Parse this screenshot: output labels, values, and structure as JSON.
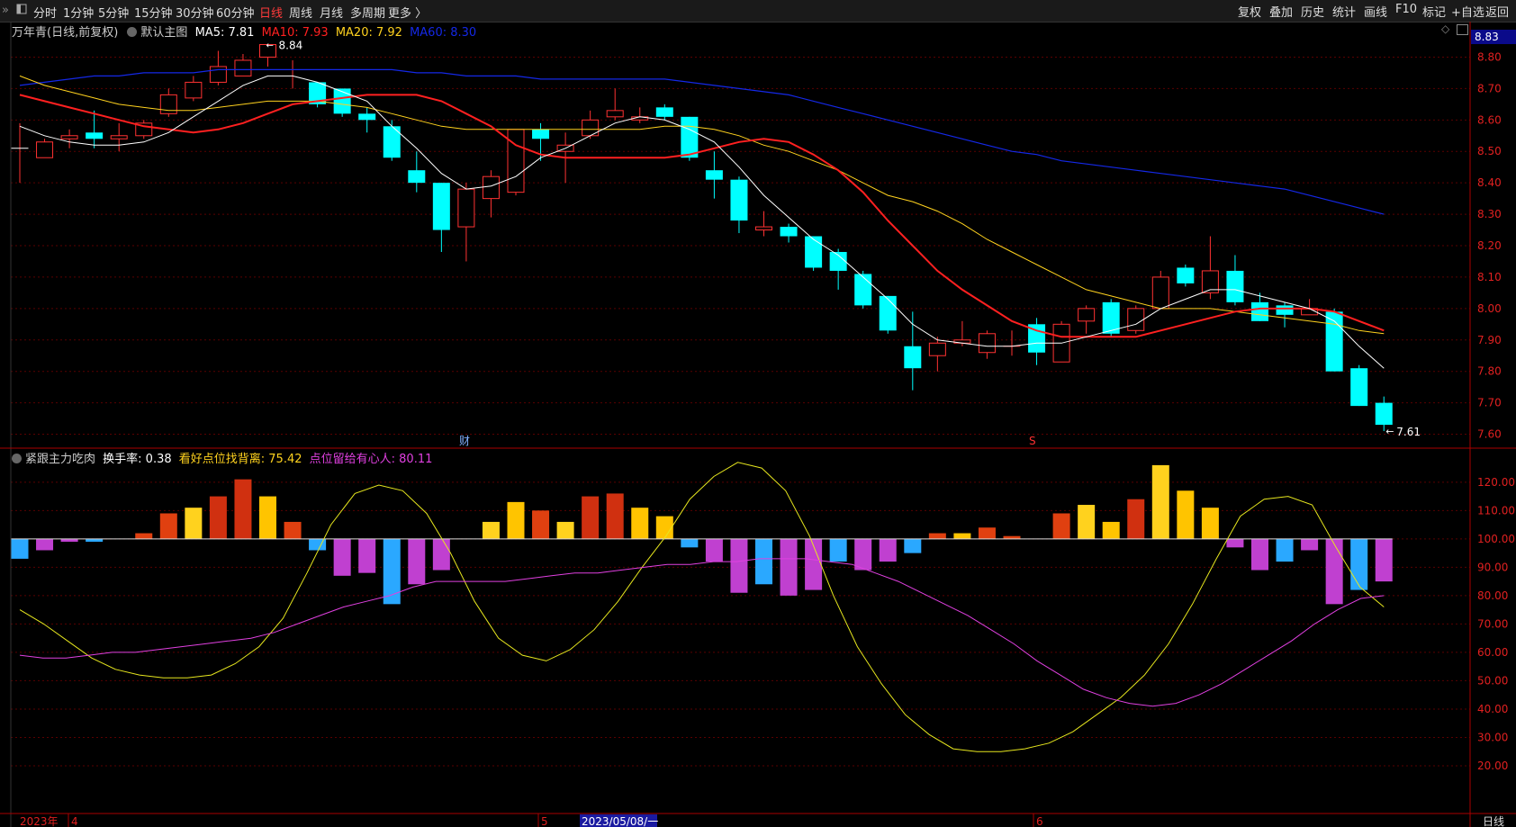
{
  "toolbar": {
    "periods": [
      "分时",
      "1分钟",
      "5分钟",
      "15分钟",
      "30分钟",
      "60分钟",
      "日线",
      "周线",
      "月线",
      "多周期",
      "更多 〉"
    ],
    "active_period": "日线",
    "right_buttons": [
      "复权",
      "叠加",
      "历史",
      "统计",
      "画线",
      "F10",
      "标记",
      "+自选",
      "返回"
    ]
  },
  "main_legend": {
    "title": "万年青(日线,前复权)",
    "indicator": "默认主图",
    "ma5": "MA5: 7.81",
    "ma10": "MA10: 7.93",
    "ma20": "MA20: 7.92",
    "ma60": "MA60: 8.30"
  },
  "sub_legend": {
    "title": "紧跟主力吃肉",
    "turnover": "换手率: 0.38",
    "bullish": "看好点位找背离: 75.42",
    "magenta": "点位留给有心人: 80.11"
  },
  "price_tag": "8.83",
  "annotations": {
    "high_label": "8.84",
    "low_label": "7.61",
    "event_cai": "财",
    "event_s": "S"
  },
  "x_axis": {
    "year": "2023年",
    "m4": "4",
    "m5": "5",
    "m6": "6",
    "cursor_date": "2023/05/08/一",
    "period_label": "日线"
  },
  "colors": {
    "up": "#ff3232",
    "down": "#00ffff",
    "ma5": "#ffffff",
    "ma10": "#ff2020",
    "ma20": "#ffd21e",
    "ma60": "#1428e6",
    "grid": "#5a0000",
    "axis": "#aa0000"
  },
  "chart_data": [
    {
      "type": "candlestick",
      "ylim": [
        7.55,
        8.83
      ],
      "y_ticks": [
        7.6,
        7.7,
        7.8,
        7.9,
        8.0,
        8.1,
        8.2,
        8.3,
        8.4,
        8.5,
        8.6,
        8.7,
        8.8
      ],
      "candles": [
        [
          8.51,
          8.51,
          8.59,
          8.4
        ],
        [
          8.48,
          8.53,
          8.54,
          8.48
        ],
        [
          8.54,
          8.55,
          8.57,
          8.51
        ],
        [
          8.56,
          8.54,
          8.63,
          8.51
        ],
        [
          8.54,
          8.55,
          8.59,
          8.5
        ],
        [
          8.55,
          8.59,
          8.6,
          8.54
        ],
        [
          8.62,
          8.68,
          8.7,
          8.61
        ],
        [
          8.67,
          8.72,
          8.74,
          8.66
        ],
        [
          8.72,
          8.77,
          8.82,
          8.71
        ],
        [
          8.74,
          8.79,
          8.81,
          8.74
        ],
        [
          8.8,
          8.84,
          8.84,
          8.77
        ],
        [
          8.76,
          8.76,
          8.79,
          8.7
        ],
        [
          8.72,
          8.65,
          8.72,
          8.64
        ],
        [
          8.7,
          8.62,
          8.7,
          8.61
        ],
        [
          8.62,
          8.6,
          8.64,
          8.56
        ],
        [
          8.58,
          8.48,
          8.6,
          8.47
        ],
        [
          8.44,
          8.4,
          8.5,
          8.37
        ],
        [
          8.4,
          8.25,
          8.4,
          8.18
        ],
        [
          8.26,
          8.38,
          8.4,
          8.15
        ],
        [
          8.35,
          8.42,
          8.44,
          8.29
        ],
        [
          8.37,
          8.57,
          8.57,
          8.36
        ],
        [
          8.57,
          8.54,
          8.59,
          8.47
        ],
        [
          8.5,
          8.52,
          8.56,
          8.4
        ],
        [
          8.55,
          8.6,
          8.63,
          8.54
        ],
        [
          8.61,
          8.63,
          8.7,
          8.6
        ],
        [
          8.6,
          8.61,
          8.64,
          8.59
        ],
        [
          8.64,
          8.61,
          8.65,
          8.6
        ],
        [
          8.61,
          8.48,
          8.61,
          8.47
        ],
        [
          8.44,
          8.41,
          8.5,
          8.35
        ],
        [
          8.41,
          8.28,
          8.42,
          8.24
        ],
        [
          8.25,
          8.26,
          8.31,
          8.23
        ],
        [
          8.26,
          8.23,
          8.27,
          8.21
        ],
        [
          8.23,
          8.13,
          8.23,
          8.12
        ],
        [
          8.18,
          8.12,
          8.19,
          8.06
        ],
        [
          8.11,
          8.01,
          8.12,
          8.0
        ],
        [
          8.04,
          7.93,
          8.04,
          7.92
        ],
        [
          7.88,
          7.81,
          7.99,
          7.74
        ],
        [
          7.85,
          7.89,
          7.91,
          7.8
        ],
        [
          7.89,
          7.9,
          7.96,
          7.88
        ],
        [
          7.86,
          7.92,
          7.93,
          7.84
        ],
        [
          7.88,
          7.88,
          7.93,
          7.85
        ],
        [
          7.95,
          7.86,
          7.97,
          7.82
        ],
        [
          7.83,
          7.95,
          7.96,
          7.83
        ],
        [
          7.96,
          8.0,
          8.01,
          7.92
        ],
        [
          8.02,
          7.92,
          8.03,
          7.91
        ],
        [
          7.93,
          8.0,
          8.01,
          7.92
        ],
        [
          8.0,
          8.1,
          8.12,
          8.0
        ],
        [
          8.13,
          8.08,
          8.14,
          8.07
        ],
        [
          8.05,
          8.12,
          8.23,
          8.03
        ],
        [
          8.12,
          8.02,
          8.17,
          8.01
        ],
        [
          8.02,
          7.96,
          8.05,
          7.96
        ],
        [
          8.01,
          7.98,
          8.02,
          7.94
        ],
        [
          7.98,
          8.0,
          8.03,
          7.98
        ],
        [
          7.99,
          7.8,
          8.0,
          7.8
        ],
        [
          7.81,
          7.69,
          7.82,
          7.69
        ],
        [
          7.7,
          7.63,
          7.72,
          7.61
        ]
      ],
      "ma5": [
        8.58,
        8.55,
        8.53,
        8.52,
        8.52,
        8.53,
        8.56,
        8.61,
        8.66,
        8.71,
        8.74,
        8.74,
        8.72,
        8.69,
        8.66,
        8.58,
        8.51,
        8.43,
        8.38,
        8.39,
        8.42,
        8.48,
        8.51,
        8.55,
        8.59,
        8.61,
        8.6,
        8.57,
        8.53,
        8.45,
        8.36,
        8.29,
        8.22,
        8.17,
        8.1,
        8.03,
        7.95,
        7.9,
        7.89,
        7.88,
        7.88,
        7.89,
        7.89,
        7.91,
        7.93,
        7.95,
        8.0,
        8.03,
        8.06,
        8.06,
        8.04,
        8.02,
        8.0,
        7.96,
        7.88,
        7.81
      ],
      "ma10": [
        8.68,
        8.66,
        8.64,
        8.62,
        8.6,
        8.58,
        8.57,
        8.56,
        8.57,
        8.59,
        8.62,
        8.65,
        8.66,
        8.67,
        8.68,
        8.68,
        8.68,
        8.66,
        8.62,
        8.58,
        8.52,
        8.49,
        8.48,
        8.48,
        8.48,
        8.48,
        8.48,
        8.49,
        8.51,
        8.53,
        8.54,
        8.53,
        8.49,
        8.44,
        8.37,
        8.28,
        8.2,
        8.12,
        8.06,
        8.01,
        7.96,
        7.93,
        7.91,
        7.91,
        7.91,
        7.91,
        7.93,
        7.95,
        7.97,
        7.99,
        8.0,
        8.0,
        8.0,
        7.99,
        7.96,
        7.93
      ],
      "ma20": [
        8.74,
        8.71,
        8.69,
        8.67,
        8.65,
        8.64,
        8.63,
        8.63,
        8.64,
        8.65,
        8.66,
        8.66,
        8.66,
        8.65,
        8.64,
        8.62,
        8.6,
        8.58,
        8.57,
        8.57,
        8.57,
        8.57,
        8.57,
        8.57,
        8.57,
        8.57,
        8.58,
        8.58,
        8.57,
        8.55,
        8.52,
        8.5,
        8.47,
        8.44,
        8.4,
        8.36,
        8.34,
        8.31,
        8.27,
        8.22,
        8.18,
        8.14,
        8.1,
        8.06,
        8.04,
        8.02,
        8.0,
        8.0,
        8.0,
        7.99,
        7.98,
        7.97,
        7.96,
        7.95,
        7.93,
        7.92
      ],
      "ma60": [
        8.71,
        8.72,
        8.73,
        8.74,
        8.74,
        8.75,
        8.75,
        8.75,
        8.76,
        8.76,
        8.76,
        8.76,
        8.76,
        8.76,
        8.76,
        8.76,
        8.75,
        8.75,
        8.74,
        8.74,
        8.74,
        8.73,
        8.73,
        8.73,
        8.73,
        8.73,
        8.73,
        8.72,
        8.71,
        8.7,
        8.69,
        8.68,
        8.66,
        8.64,
        8.62,
        8.6,
        8.58,
        8.56,
        8.54,
        8.52,
        8.5,
        8.49,
        8.47,
        8.46,
        8.45,
        8.44,
        8.43,
        8.42,
        8.41,
        8.4,
        8.39,
        8.38,
        8.36,
        8.34,
        8.32,
        8.3
      ]
    },
    {
      "type": "bar",
      "ylim": [
        0,
        132
      ],
      "y_ticks": [
        20,
        30,
        40,
        50,
        60,
        70,
        80,
        90,
        100,
        110,
        120
      ],
      "baseline": 100,
      "bars": [
        93,
        96,
        99,
        99,
        100,
        102,
        109,
        111,
        115,
        121,
        115,
        106,
        96,
        87,
        88,
        77,
        84,
        89,
        100,
        106,
        113,
        110,
        106,
        115,
        116,
        111,
        108,
        97,
        92,
        81,
        84,
        80,
        82,
        92,
        89,
        92,
        95,
        102,
        102,
        104,
        101,
        100,
        109,
        112,
        106,
        114,
        126,
        117,
        111,
        97,
        89,
        92,
        96,
        77,
        82,
        85
      ],
      "yellow_line": [
        75,
        70,
        64,
        58,
        54,
        52,
        51,
        51,
        52,
        56,
        62,
        72,
        88,
        105,
        116,
        119,
        117,
        109,
        95,
        78,
        65,
        59,
        57,
        61,
        68,
        78,
        90,
        101,
        114,
        122,
        127,
        125,
        117,
        101,
        80,
        62,
        49,
        38,
        31,
        26,
        25,
        25,
        26,
        28,
        32,
        38,
        44,
        52,
        63,
        77,
        93,
        108,
        114,
        115,
        112,
        97,
        83,
        76
      ],
      "magenta_line": [
        59,
        58,
        58,
        59,
        60,
        60,
        61,
        62,
        63,
        64,
        65,
        67,
        70,
        73,
        76,
        78,
        80,
        83,
        85,
        85,
        85,
        85,
        86,
        87,
        88,
        88,
        89,
        90,
        91,
        91,
        92,
        92,
        93,
        93,
        93,
        92,
        91,
        88,
        85,
        81,
        77,
        73,
        68,
        63,
        57,
        52,
        47,
        44,
        42,
        41,
        42,
        45,
        49,
        54,
        59,
        64,
        70,
        75,
        79,
        80
      ]
    }
  ]
}
